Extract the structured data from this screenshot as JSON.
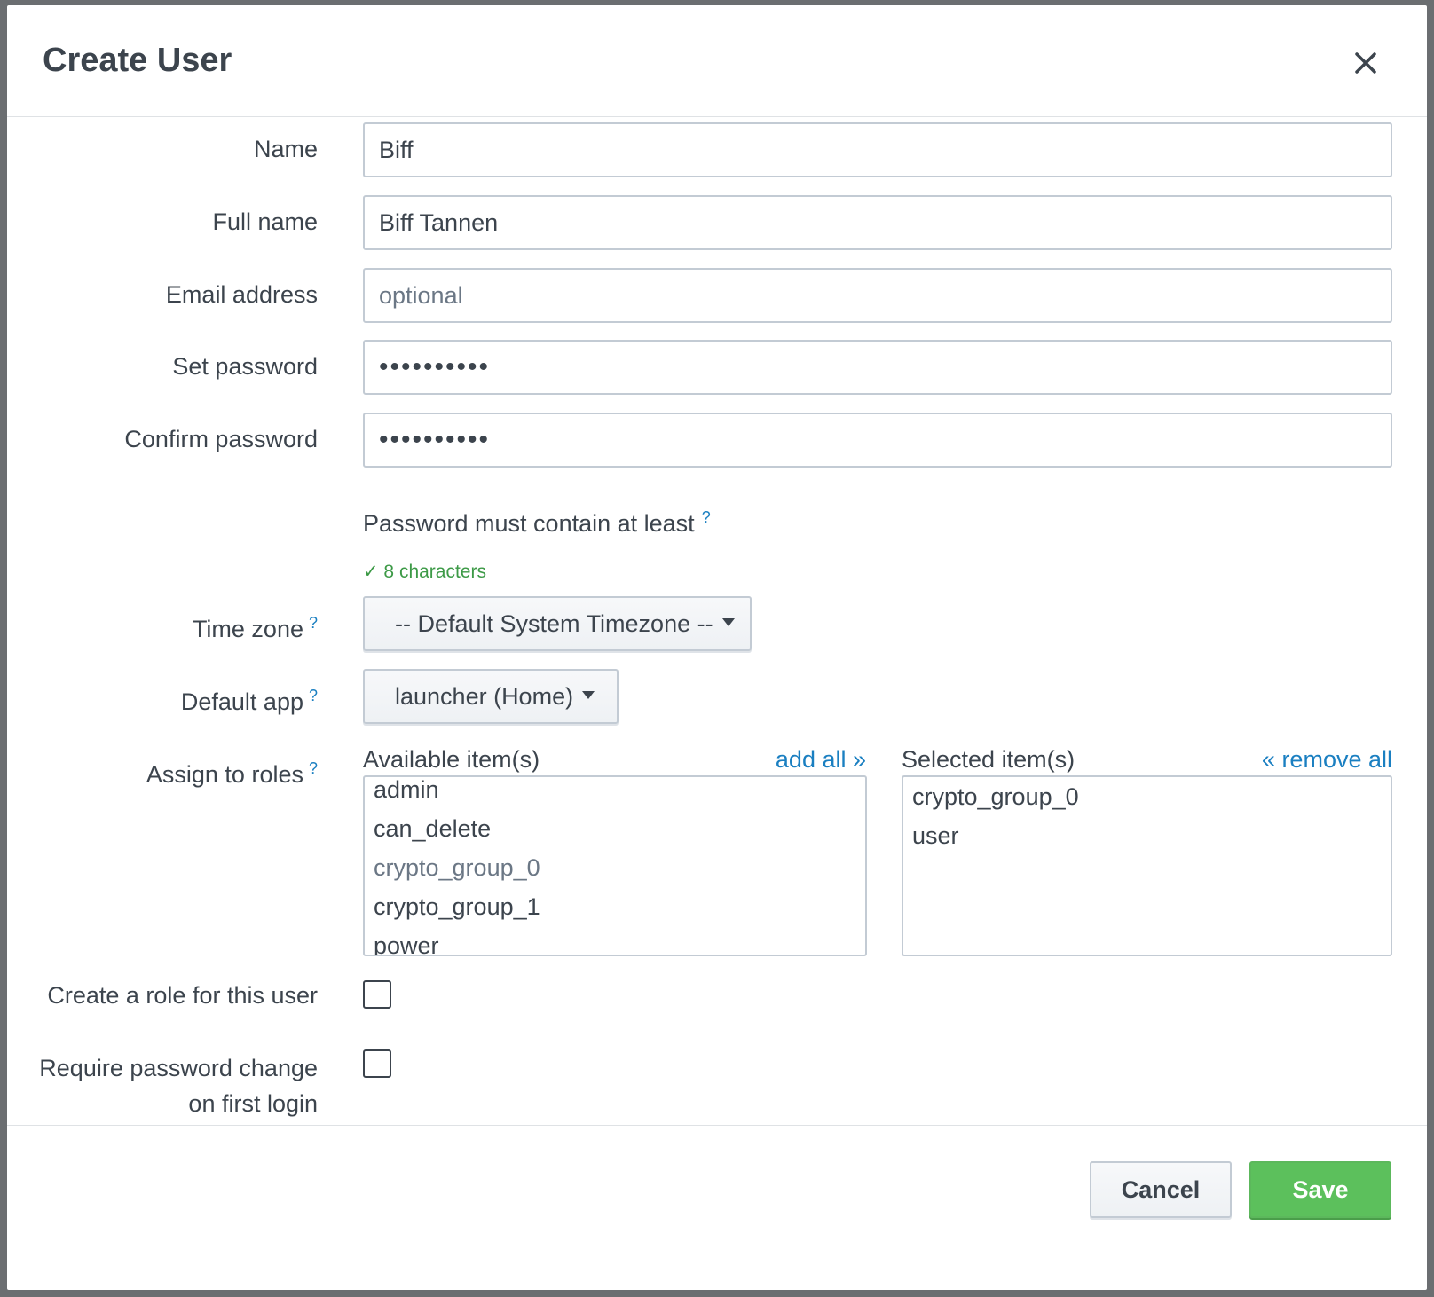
{
  "dialog": {
    "title": "Create User"
  },
  "form": {
    "name": {
      "label": "Name",
      "value": "Biff"
    },
    "full_name": {
      "label": "Full name",
      "value": "Biff Tannen"
    },
    "email": {
      "label": "Email address",
      "value": "",
      "placeholder": "optional"
    },
    "password": {
      "label": "Set password",
      "value": "••••••••••"
    },
    "confirm_password": {
      "label": "Confirm password",
      "value": "••••••••••"
    },
    "password_hint": {
      "text": "Password must contain at least",
      "help": "?"
    },
    "password_rule": {
      "text": "✓ 8 characters",
      "color": "#3d9a47"
    },
    "time_zone": {
      "label": "Time zone",
      "help": "?",
      "selected": "-- Default System Timezone --"
    },
    "default_app": {
      "label": "Default app",
      "help": "?",
      "selected": "launcher (Home)"
    },
    "roles": {
      "label": "Assign to roles",
      "help": "?",
      "available_title": "Available item(s)",
      "add_all": "add all »",
      "available": [
        "admin",
        "can_delete",
        "crypto_group_0",
        "crypto_group_1",
        "power"
      ],
      "selected_title": "Selected item(s)",
      "remove_all": "« remove all",
      "selected": [
        "crypto_group_0",
        "user"
      ]
    },
    "create_role": {
      "label": "Create a role for this user",
      "checked": false
    },
    "require_change": {
      "label_line1": "Require password change",
      "label_line2": "on first login",
      "checked": false
    }
  },
  "footer": {
    "cancel_label": "Cancel",
    "save_label": "Save"
  },
  "colors": {
    "accent_link": "#1a7fc1",
    "save_green": "#5cc05c",
    "text": "#3c444d"
  }
}
